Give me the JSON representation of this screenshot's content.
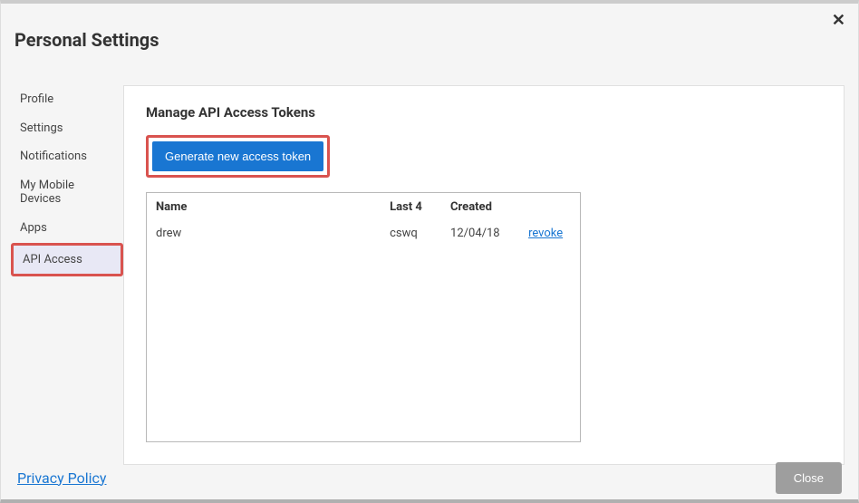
{
  "page_title": "Personal Settings",
  "close_x": "✕",
  "sidebar": {
    "items": [
      {
        "label": "Profile",
        "active": false
      },
      {
        "label": "Settings",
        "active": false
      },
      {
        "label": "Notifications",
        "active": false
      },
      {
        "label": "My Mobile Devices",
        "active": false
      },
      {
        "label": "Apps",
        "active": false
      },
      {
        "label": "API Access",
        "active": true
      }
    ]
  },
  "main": {
    "heading": "Manage API Access Tokens",
    "generate_label": "Generate new access token",
    "table": {
      "headers": {
        "name": "Name",
        "last4": "Last 4",
        "created": "Created",
        "action": ""
      },
      "rows": [
        {
          "name": "drew",
          "last4": "cswq",
          "created": "12/04/18",
          "action": "revoke"
        }
      ]
    }
  },
  "footer": {
    "privacy": "Privacy Policy",
    "close": "Close"
  }
}
